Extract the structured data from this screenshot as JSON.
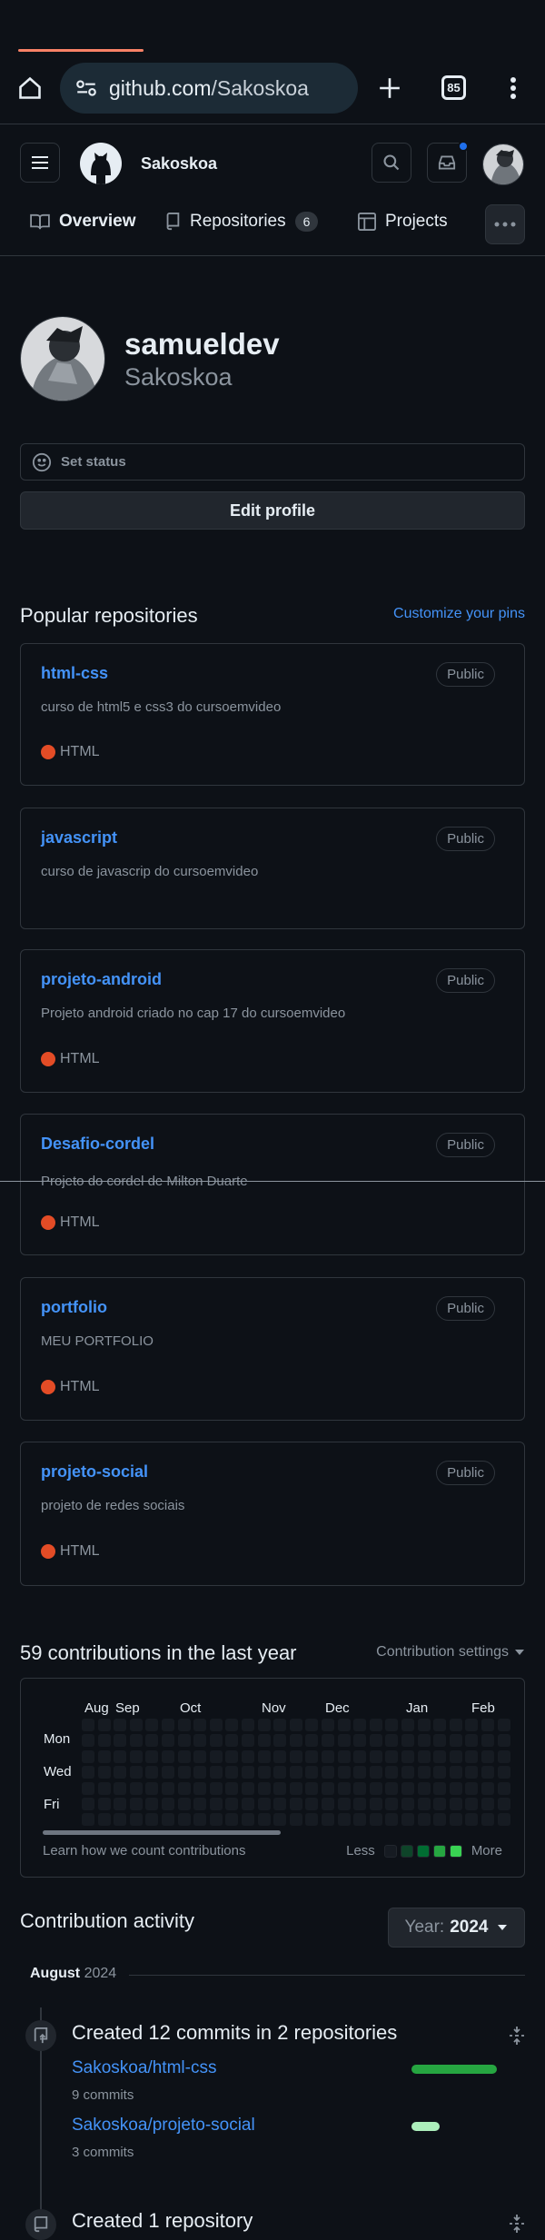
{
  "browser": {
    "url_host": "github.com",
    "url_path": "/Sakoskoa",
    "tab_count": "85"
  },
  "header": {
    "username": "Sakoskoa"
  },
  "tabs": [
    {
      "label": "Overview"
    },
    {
      "label": "Repositories",
      "count": "6"
    },
    {
      "label": "Projects"
    }
  ],
  "profile": {
    "name": "samueldev",
    "login": "Sakoskoa",
    "status": "Set status",
    "edit_button": "Edit profile"
  },
  "popular": {
    "title": "Popular repositories",
    "customize": "Customize your pins",
    "repos": [
      {
        "name": "html-css",
        "visibility": "Public",
        "description": "curso de html5 e css3 do cursoemvideo",
        "language": "HTML"
      },
      {
        "name": "javascript",
        "visibility": "Public",
        "description": "curso de javascrip do cursoemvideo",
        "language": ""
      },
      {
        "name": "projeto-android",
        "visibility": "Public",
        "description": "Projeto android criado no cap 17 do cursoemvideo",
        "language": "HTML"
      },
      {
        "name": "Desafio-cordel",
        "visibility": "Public",
        "description": "Projeto do cordel de Milton Duarte",
        "language": "HTML"
      },
      {
        "name": "portfolio",
        "visibility": "Public",
        "description": "MEU PORTFOLIO",
        "language": "HTML"
      },
      {
        "name": "projeto-social",
        "visibility": "Public",
        "description": "projeto de redes sociais",
        "language": "HTML"
      }
    ],
    "language_color": "#e34c26"
  },
  "contributions": {
    "title": "59 contributions in the last year",
    "settings": "Contribution settings",
    "months": [
      "Aug",
      "Sep",
      "Oct",
      "Nov",
      "Dec",
      "Jan",
      "Feb"
    ],
    "days": [
      "Mon",
      "Wed",
      "Fri"
    ],
    "learn": "Learn how we count contributions",
    "less": "Less",
    "more": "More",
    "legend_colors": [
      "#161b22",
      "#0e4429",
      "#006d32",
      "#26a641",
      "#39d353"
    ]
  },
  "activity": {
    "title": "Contribution activity",
    "year_label": "Year:",
    "year": "2024",
    "month": "August",
    "month_year": "2024",
    "events": [
      {
        "title": "Created 12 commits in 2 repositories",
        "repos": [
          {
            "name": "Sakoskoa/html-css",
            "commits": "9 commits",
            "fraction": 1.0,
            "color": "#26a641"
          },
          {
            "name": "Sakoskoa/projeto-social",
            "commits": "3 commits",
            "fraction": 0.33,
            "color": "#aceebb"
          }
        ]
      },
      {
        "title": "Created 1 repository"
      }
    ]
  }
}
